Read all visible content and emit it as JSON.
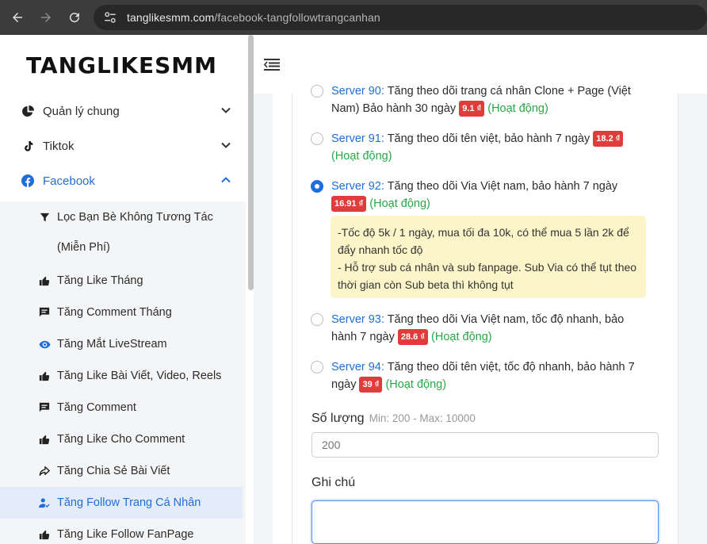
{
  "browser": {
    "url_domain": "tanglikesmm.com",
    "url_path": "/facebook-tangfollowtrangcanhan"
  },
  "sidebar": {
    "brand": "TANGLIKESMM",
    "menus": [
      {
        "label": "Quản lý chung",
        "icon": "chart-pie-icon"
      },
      {
        "label": "Tiktok",
        "icon": "tiktok-icon"
      },
      {
        "label": "Facebook",
        "icon": "facebook-icon"
      }
    ],
    "facebook_items": [
      {
        "label": "Lọc Bạn Bè Không Tương Tác",
        "label_cont": "(Miễn Phí)",
        "icon": "filter-icon"
      },
      {
        "label": "Tăng Like Tháng",
        "icon": "thumbs-up-icon"
      },
      {
        "label": "Tăng Comment Tháng",
        "icon": "comment-icon"
      },
      {
        "label": "Tăng Mắt LiveStream",
        "icon": "eye-icon"
      },
      {
        "label": "Tăng Like Bài Viết, Video, Reels",
        "icon": "thumbs-up-icon"
      },
      {
        "label": "Tăng Comment",
        "icon": "comment-icon"
      },
      {
        "label": "Tăng Like Cho Comment",
        "icon": "thumbs-up-icon"
      },
      {
        "label": "Tăng Chia Sẻ Bài Viết",
        "icon": "share-icon"
      },
      {
        "label": "Tăng Follow Trang Cá Nhân",
        "icon": "user-follow-icon"
      },
      {
        "label": "Tăng Like Follow FanPage",
        "icon": "thumbs-up-icon"
      }
    ]
  },
  "servers": [
    {
      "name": "Server 90:",
      "desc": "Tăng theo dõi trang cá nhân Clone + Page (Việt Nam) Bảo hành 30 ngày",
      "price": "9.1 ₫",
      "status": "(Hoạt động)",
      "selected": false
    },
    {
      "name": "Server 91:",
      "desc": "Tăng theo dõi tên việt, bảo hành 7 ngày",
      "price": "18.2 ₫",
      "status": "(Hoạt động)",
      "selected": false
    },
    {
      "name": "Server 92:",
      "desc": "Tăng theo dõi Via Việt nam, bảo hành 7 ngày",
      "price": "16.91 ₫",
      "status": "(Hoạt động)",
      "selected": true
    },
    {
      "name": "Server 93:",
      "desc": "Tăng theo dõi Via Việt nam, tốc độ nhanh, bảo hành 7 ngày",
      "price": "28.6 ₫",
      "status": "(Hoạt động)",
      "selected": false
    },
    {
      "name": "Server 94:",
      "desc": "Tăng theo dõi tên việt, tốc độ nhanh, bảo hành 7 ngày",
      "price": "39 ₫",
      "status": "(Hoạt động)",
      "selected": false
    }
  ],
  "note": {
    "line1": "-Tốc độ 5k / 1 ngày, mua tối đa 10k, có thể mua 5 lần 2k để đẩy nhanh tốc độ",
    "line2": "- Hỗ trợ sub cá nhân và sub fanpage. Sub Via có thể tụt theo thời gian còn Sub beta thì không tụt"
  },
  "form": {
    "quantity_label": "Số lượng",
    "quantity_hint": "Min: 200 - Max: 10000",
    "quantity_value": "200",
    "note_label": "Ghi chú",
    "note_value": ""
  },
  "colors": {
    "accent": "#1f6fd6",
    "price_badge": "#e03c3c",
    "status_green": "#28a745",
    "note_bg": "#fcf5c9"
  }
}
